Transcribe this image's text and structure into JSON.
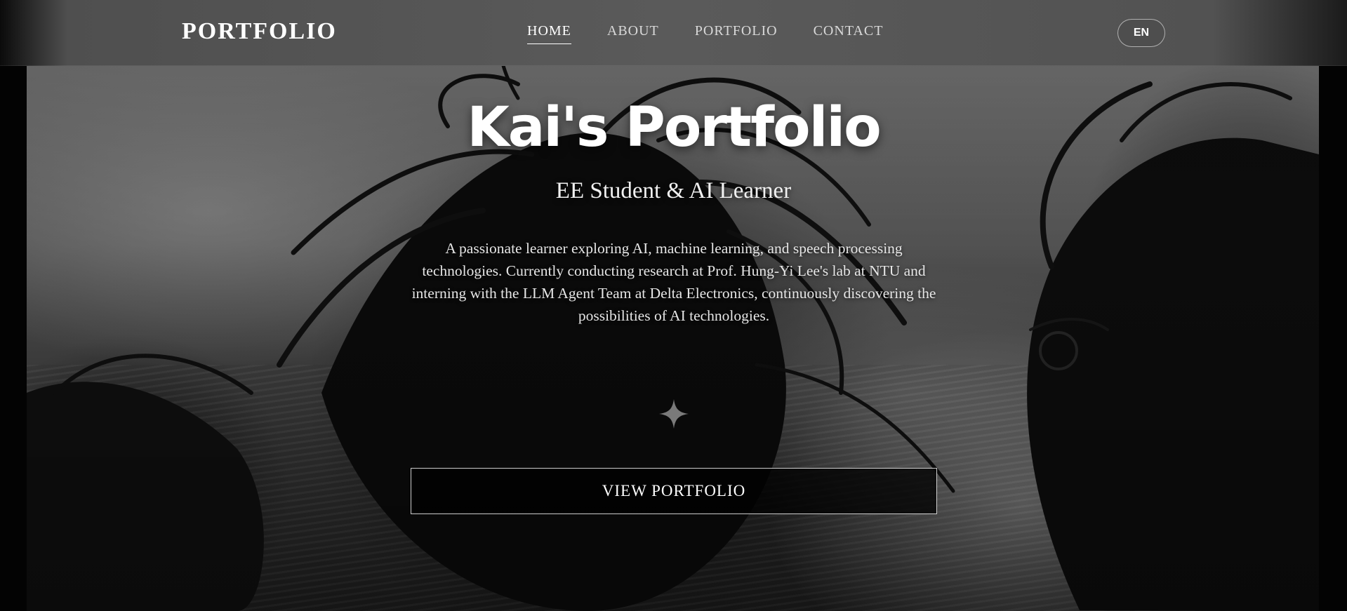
{
  "header": {
    "brand": "PORTFOLIO",
    "nav": [
      {
        "label": "HOME",
        "active": true
      },
      {
        "label": "ABOUT",
        "active": false
      },
      {
        "label": "PORTFOLIO",
        "active": false
      },
      {
        "label": "CONTACT",
        "active": false
      }
    ],
    "language_button": "EN"
  },
  "hero": {
    "title": "Kai's Portfolio",
    "subtitle": "EE Student & AI Learner",
    "description": "A passionate learner exploring AI, machine learning, and speech processing technologies. Currently conducting research at Prof. Hung-Yi Lee's lab at NTU and interning with the LLM Agent Team at Delta Electronics, continuously discovering the possibilities of AI technologies.",
    "divider_icon": "sparkle-icon",
    "cta_label": "VIEW PORTFOLIO"
  },
  "colors": {
    "text": "#ffffff",
    "nav_bg": "#5a5a5a",
    "cta_bg": "#000000"
  }
}
